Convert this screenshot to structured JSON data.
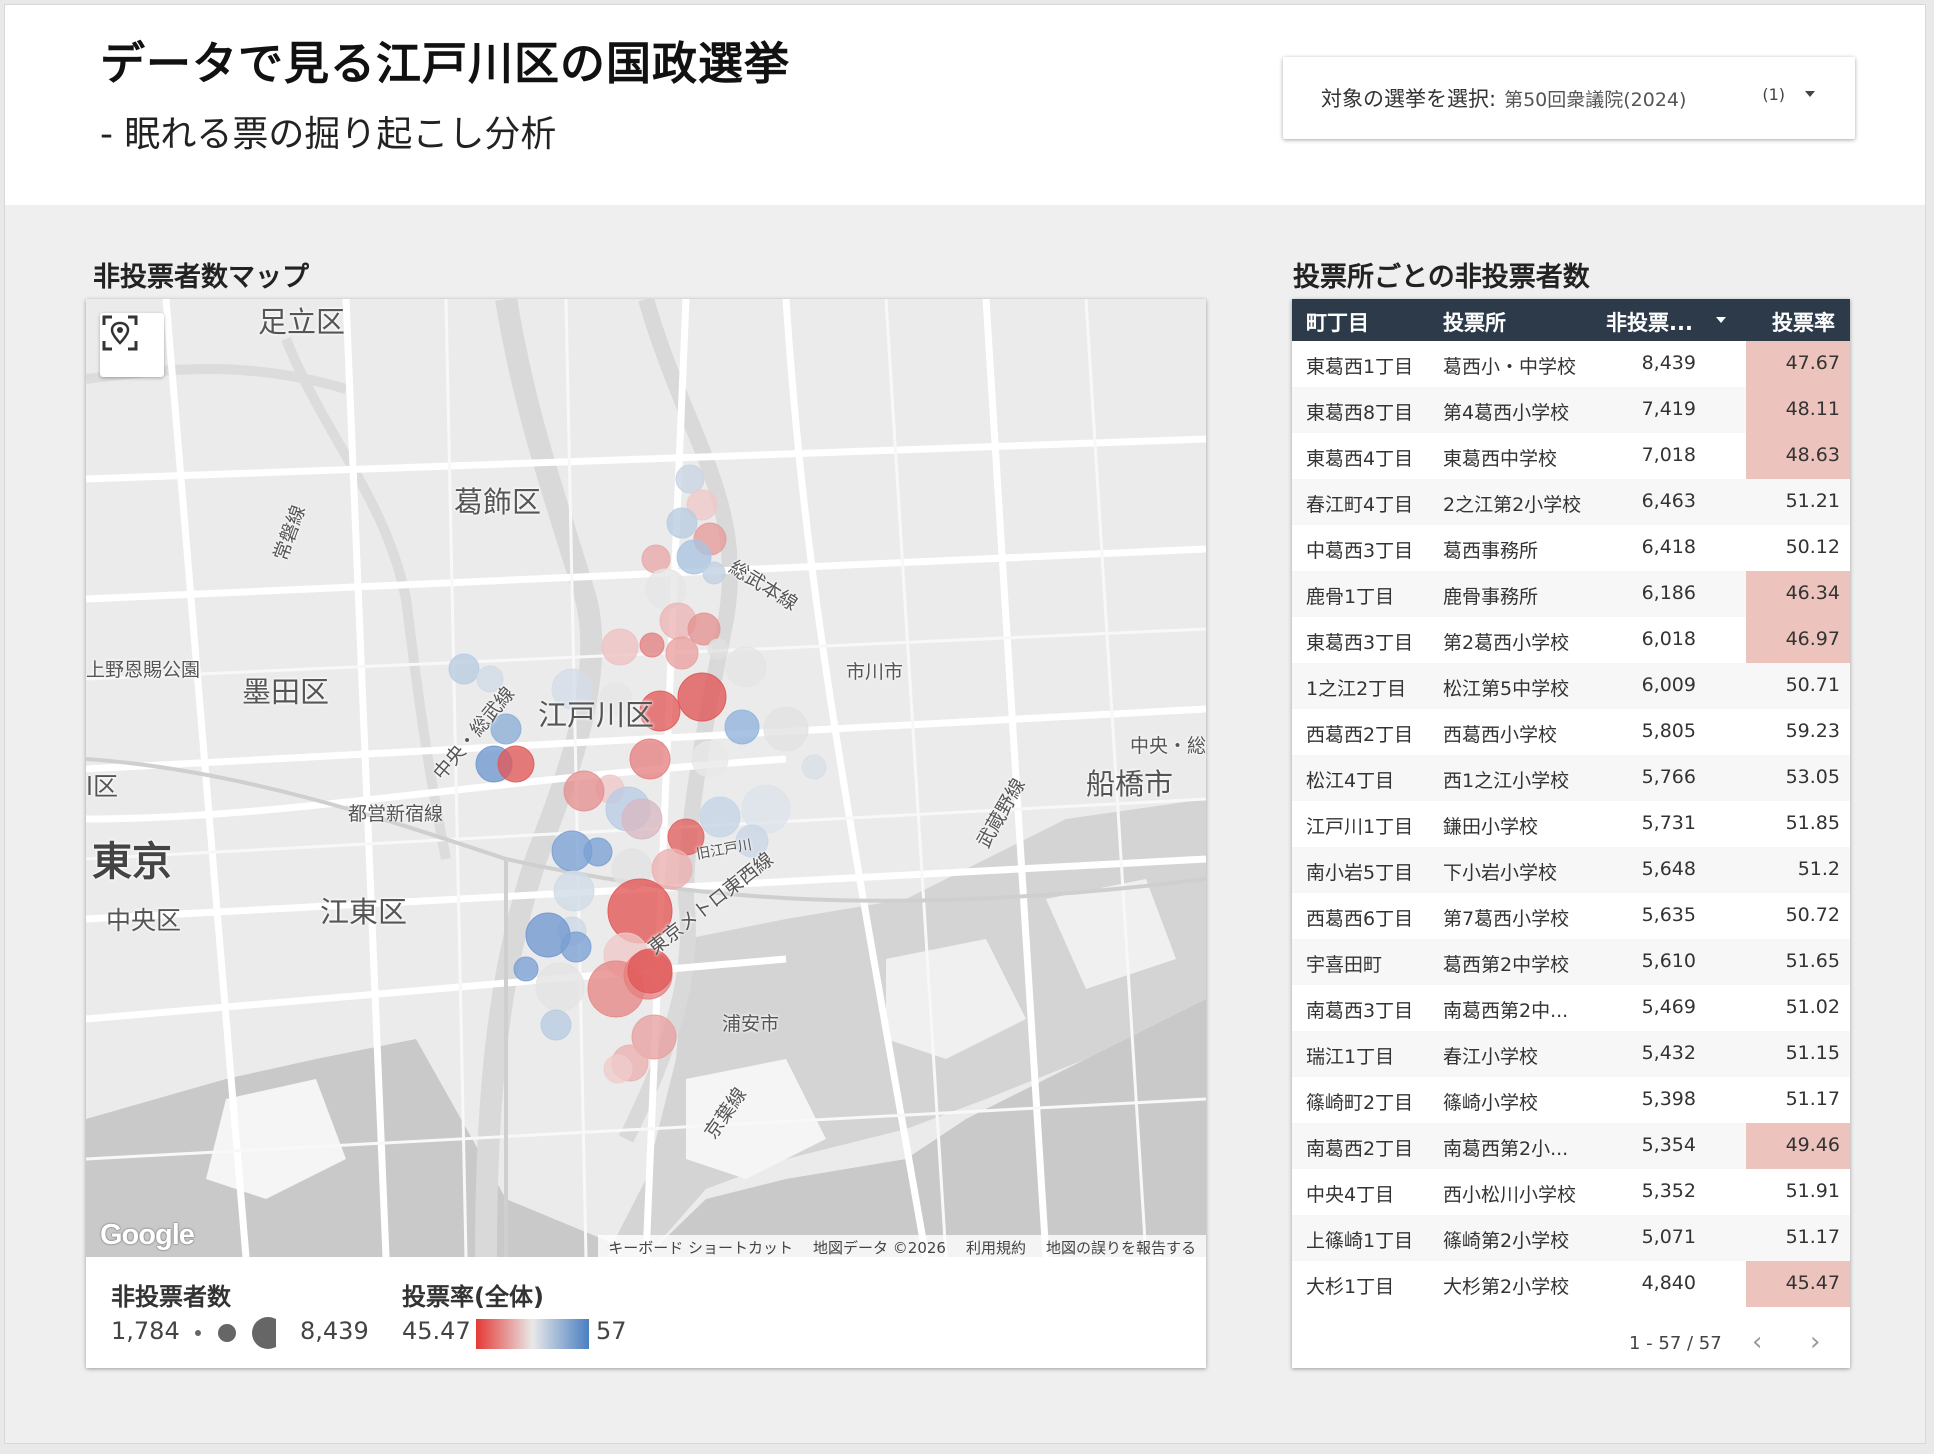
{
  "header": {
    "title": "データで見る江戸川区の国政選挙",
    "subtitle": "- 眠れる票の掘り起こし分析",
    "selector": {
      "label": "対象の選挙を選択:",
      "value": "第50回衆議院(2024)",
      "count": "(1)"
    }
  },
  "map_section": {
    "title": "非投票者数マップ",
    "labels": {
      "adachi": "足立区",
      "katsushika": "葛飾区",
      "sumida": "墨田区",
      "edogawa": "江戸川区",
      "koto": "江東区",
      "tokyo": "東京",
      "chuo": "中央区",
      "ichikawa": "市川市",
      "funabashi": "船橋市",
      "urayasu": "浦安市",
      "ueno": "上野恩賜公園",
      "ku_left": "l区",
      "joban": "常磐線",
      "sobu": "総武本線",
      "sobu2": "中央・総武線",
      "toei": "都営新宿線",
      "musashino": "武蔵野線",
      "tozai": "東京メトロ東西線",
      "keiyo": "京葉線",
      "chuosobu_right": "中央・総",
      "edogawa_river": "旧江戸川"
    },
    "google": "Google",
    "attribution": [
      "キーボード ショートカット",
      "地図データ ©2026",
      "利用規約",
      "地図の誤りを報告する"
    ],
    "legend": {
      "size_title": "非投票者数",
      "size_min": "1,784",
      "size_max": "8,439",
      "color_title": "投票率(全体)",
      "color_min": "45.47",
      "color_max": "57",
      "colors": {
        "low": "#e53935",
        "mid": "#e8e8e8",
        "high": "#4a7fc1"
      }
    }
  },
  "table_section": {
    "title": "投票所ごとの非投票者数",
    "columns": [
      "町丁目",
      "投票所",
      "非投票...",
      "投票率"
    ],
    "rows": [
      {
        "town": "東葛西1丁目",
        "place": "葛西小・中学校",
        "count": "8,439",
        "rate": "47.67",
        "low": true
      },
      {
        "town": "東葛西8丁目",
        "place": "第4葛西小学校",
        "count": "7,419",
        "rate": "48.11",
        "low": true
      },
      {
        "town": "東葛西4丁目",
        "place": "東葛西中学校",
        "count": "7,018",
        "rate": "48.63",
        "low": true
      },
      {
        "town": "春江町4丁目",
        "place": "2之江第2小学校",
        "count": "6,463",
        "rate": "51.21",
        "low": false
      },
      {
        "town": "中葛西3丁目",
        "place": "葛西事務所",
        "count": "6,418",
        "rate": "50.12",
        "low": false
      },
      {
        "town": "鹿骨1丁目",
        "place": "鹿骨事務所",
        "count": "6,186",
        "rate": "46.34",
        "low": true
      },
      {
        "town": "東葛西3丁目",
        "place": "第2葛西小学校",
        "count": "6,018",
        "rate": "46.97",
        "low": true
      },
      {
        "town": "1之江2丁目",
        "place": "松江第5中学校",
        "count": "6,009",
        "rate": "50.71",
        "low": false
      },
      {
        "town": "西葛西2丁目",
        "place": "西葛西小学校",
        "count": "5,805",
        "rate": "59.23",
        "low": false
      },
      {
        "town": "松江4丁目",
        "place": "西1之江小学校",
        "count": "5,766",
        "rate": "53.05",
        "low": false
      },
      {
        "town": "江戸川1丁目",
        "place": "鎌田小学校",
        "count": "5,731",
        "rate": "51.85",
        "low": false
      },
      {
        "town": "南小岩5丁目",
        "place": "下小岩小学校",
        "count": "5,648",
        "rate": "51.2",
        "low": false
      },
      {
        "town": "西葛西6丁目",
        "place": "第7葛西小学校",
        "count": "5,635",
        "rate": "50.72",
        "low": false
      },
      {
        "town": "宇喜田町",
        "place": "葛西第2中学校",
        "count": "5,610",
        "rate": "51.65",
        "low": false
      },
      {
        "town": "南葛西3丁目",
        "place": "南葛西第2中...",
        "count": "5,469",
        "rate": "51.02",
        "low": false
      },
      {
        "town": "瑞江1丁目",
        "place": "春江小学校",
        "count": "5,432",
        "rate": "51.15",
        "low": false
      },
      {
        "town": "篠崎町2丁目",
        "place": "篠崎小学校",
        "count": "5,398",
        "rate": "51.17",
        "low": false
      },
      {
        "town": "南葛西2丁目",
        "place": "南葛西第2小...",
        "count": "5,354",
        "rate": "49.46",
        "low": true
      },
      {
        "town": "中央4丁目",
        "place": "西小松川小学校",
        "count": "5,352",
        "rate": "51.91",
        "low": false
      },
      {
        "town": "上篠崎1丁目",
        "place": "篠崎第2小学校",
        "count": "5,071",
        "rate": "51.17",
        "low": false
      },
      {
        "town": "大杉1丁目",
        "place": "大杉第2小学校",
        "count": "4,840",
        "rate": "45.47",
        "low": true
      }
    ],
    "pagination": "1 - 57 / 57"
  }
}
